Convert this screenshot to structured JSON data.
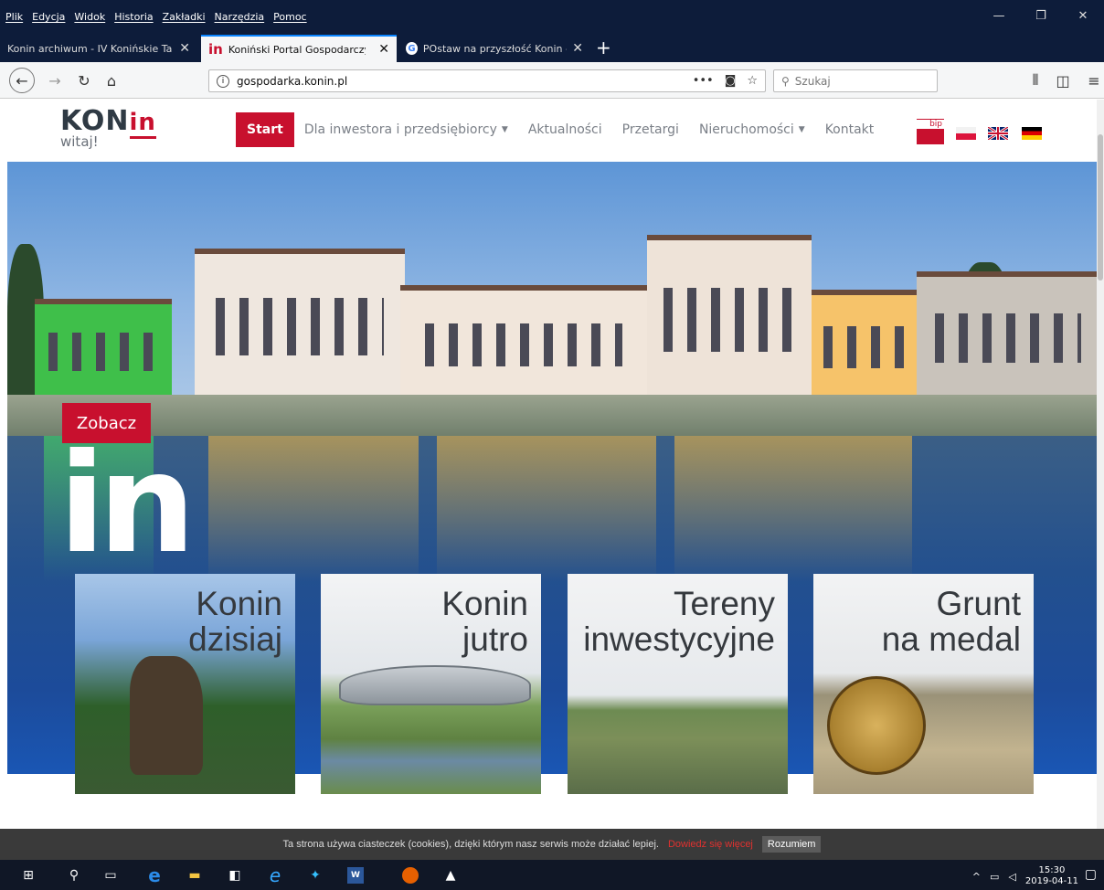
{
  "menubar": {
    "items": [
      "Plik",
      "Edycja",
      "Widok",
      "Historia",
      "Zakładki",
      "Narzędzia",
      "Pomoc"
    ]
  },
  "tabs": [
    {
      "label": "Konin archiwum - IV Konińskie Targ",
      "active": false
    },
    {
      "label": "Koniński Portal Gospodarczy",
      "active": true
    },
    {
      "label": "POstaw na przyszłość Konin - S",
      "active": false
    }
  ],
  "navbar": {
    "url": "gospodarka.konin.pl",
    "search_placeholder": "Szukaj"
  },
  "site": {
    "logo_text": "KON",
    "logo_in": "in",
    "logo_sub": "witaj!",
    "nav": [
      {
        "label": "Start",
        "active": true
      },
      {
        "label": "Dla inwestora i przedsiębiorcy",
        "caret": true
      },
      {
        "label": "Aktualności"
      },
      {
        "label": "Przetargi"
      },
      {
        "label": "Nieruchomości",
        "caret": true
      },
      {
        "label": "Kontakt"
      }
    ],
    "bip": "bip"
  },
  "hero": {
    "cta": "Zobacz",
    "big_text": "in"
  },
  "cards": [
    {
      "line1": "Konin",
      "line2": "dzisiaj"
    },
    {
      "line1": "Konin",
      "line2": "jutro"
    },
    {
      "line1": "Tereny",
      "line2": "inwestycyjne"
    },
    {
      "line1": "Grunt",
      "line2": "na medal"
    }
  ],
  "cookie": {
    "text": "Ta strona używa ciasteczek (cookies), dzięki którym nasz serwis może działać lepiej.",
    "more": "Dowiedz się więcej",
    "accept": "Rozumiem"
  },
  "taskbar": {
    "time": "15:30",
    "date": "2019-04-11"
  },
  "colors": {
    "brand": "#c8102e",
    "chrome": "#0d1c3a"
  }
}
